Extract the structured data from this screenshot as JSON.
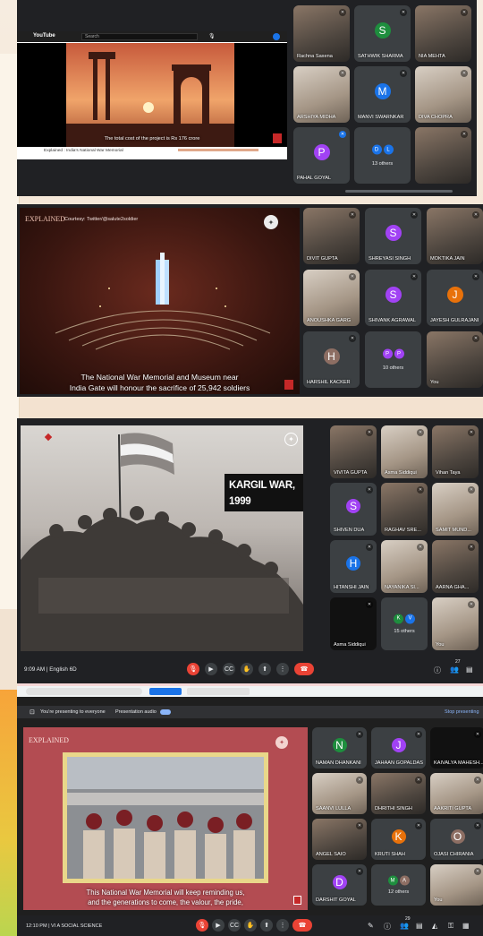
{
  "shot1": {
    "youtube_logo": "YouTube",
    "youtube_search_placeholder": "Search",
    "video_subtitle": "The total cost of the project is Rs 176 crore",
    "video_title": "Explained : India's National War Memorial",
    "participants": [
      {
        "name": "Rachna Saxena",
        "kind": "photo"
      },
      {
        "name": "SATHWIK SHARMA",
        "kind": "avatar",
        "initial": "S",
        "color": "#1e8e3e"
      },
      {
        "name": "NIA MEHTA",
        "kind": "photo"
      },
      {
        "name": "ARSHIYA MIDHA",
        "kind": "photo"
      },
      {
        "name": "MANVI SWARNKAR",
        "kind": "avatar",
        "initial": "M",
        "color": "#1a73e8"
      },
      {
        "name": "DIVA CHOPRA",
        "kind": "photo"
      },
      {
        "name": "PAHAL GOYAL",
        "kind": "avatar",
        "initial": "P",
        "color": "#a142f4"
      },
      {
        "name": "13 others",
        "kind": "others",
        "initials": [
          "D",
          "L"
        ],
        "colors": [
          "#1a73e8",
          "#1a73e8"
        ]
      },
      {
        "name": "",
        "kind": "photo"
      }
    ]
  },
  "shot2": {
    "brand": "EXPLAINED",
    "courtesy": "Courtesy: Twitter/@salute2soldier",
    "caption_line1": "The National War Memorial and Museum near",
    "caption_line2": "India Gate will honour the sacrifice of 25,942 soldiers",
    "participants": [
      {
        "name": "DIVIT GUPTA",
        "kind": "photo"
      },
      {
        "name": "SHREYASI SINGH",
        "kind": "avatar",
        "initial": "S",
        "color": "#a142f4"
      },
      {
        "name": "MOKTIKA JAIN",
        "kind": "photo"
      },
      {
        "name": "ANOUSHKA GARG",
        "kind": "photo"
      },
      {
        "name": "SHIVANK AGRAWAL",
        "kind": "avatar",
        "initial": "S",
        "color": "#a142f4"
      },
      {
        "name": "JAYESH GULRAJANI",
        "kind": "avatar",
        "initial": "J",
        "color": "#e8710a"
      },
      {
        "name": "HARSHIL KACKER",
        "kind": "avatar",
        "initial": "H",
        "color": "#8d6e63"
      },
      {
        "name": "10 others",
        "kind": "others",
        "initials": [
          "P",
          "P"
        ],
        "colors": [
          "#a142f4",
          "#a142f4"
        ]
      },
      {
        "name": "You",
        "kind": "photo"
      }
    ]
  },
  "shot3": {
    "slide_title": "KARGIL WAR, 1999",
    "time_class": "9:09 AM  |  English 6D",
    "participants": [
      {
        "name": "VIVITA GUPTA",
        "kind": "photo"
      },
      {
        "name": "Asma Siddiqui",
        "kind": "photo"
      },
      {
        "name": "Vihan Taya",
        "kind": "photo"
      },
      {
        "name": "SHIVEN DUA",
        "kind": "avatar",
        "initial": "S",
        "color": "#a142f4"
      },
      {
        "name": "RAGHAV SRE...",
        "kind": "photo"
      },
      {
        "name": "SAMIT MUND...",
        "kind": "photo"
      },
      {
        "name": "HITANSHI JAIN",
        "kind": "avatar",
        "initial": "H",
        "color": "#1a73e8"
      },
      {
        "name": "NAYANIKA SI...",
        "kind": "photo"
      },
      {
        "name": "AARNA GHA...",
        "kind": "photo"
      },
      {
        "name": "Asma Siddiqui",
        "kind": "dark"
      },
      {
        "name": "15 others",
        "kind": "others",
        "initials": [
          "K",
          "V"
        ],
        "colors": [
          "#1e8e3e",
          "#1a73e8"
        ]
      },
      {
        "name": "You",
        "kind": "photo"
      }
    ],
    "people_count": "27"
  },
  "shot4": {
    "presenting_text": "You're presenting to everyone",
    "presentation_audio": "Presentation audio",
    "stop_presenting": "Stop presenting",
    "brand": "EXPLAINED",
    "caption_line1": "This National War Memorial will keep reminding us,",
    "caption_line2": "and the generations to come, the valour, the pride,",
    "time_class": "12:10 PM  |  VI A SOCIAL SCIENCE",
    "participants": [
      {
        "name": "NAMAN DHANKANI",
        "kind": "avatar",
        "initial": "N",
        "color": "#1e8e3e"
      },
      {
        "name": "JAHAAN GOPALDAS",
        "kind": "avatar",
        "initial": "J",
        "color": "#a142f4"
      },
      {
        "name": "KAIVALYA MAHESH...",
        "kind": "dark"
      },
      {
        "name": "SAANVI LULLA",
        "kind": "photo"
      },
      {
        "name": "DHRITHI SINGH",
        "kind": "photo"
      },
      {
        "name": "AAKRITI GUPTA",
        "kind": "photo"
      },
      {
        "name": "ANGEL SAIO",
        "kind": "photo"
      },
      {
        "name": "KRUTI SHAH",
        "kind": "avatar",
        "initial": "K",
        "color": "#e8710a"
      },
      {
        "name": "OJASI CHIRANIA",
        "kind": "avatar",
        "initial": "O",
        "color": "#8d6e63"
      },
      {
        "name": "DARSHIT GOYAL",
        "kind": "avatar",
        "initial": "D",
        "color": "#a142f4"
      },
      {
        "name": "12 others",
        "kind": "others",
        "initials": [
          "M",
          "A"
        ],
        "colors": [
          "#1e8e3e",
          "#8d6e63"
        ]
      },
      {
        "name": "You",
        "kind": "photo"
      }
    ],
    "people_count": "29"
  },
  "colors": {
    "meet_bg": "#202124",
    "tile_bg": "#3c4043",
    "hangup": "#ea4335",
    "accent": "#1a73e8"
  }
}
